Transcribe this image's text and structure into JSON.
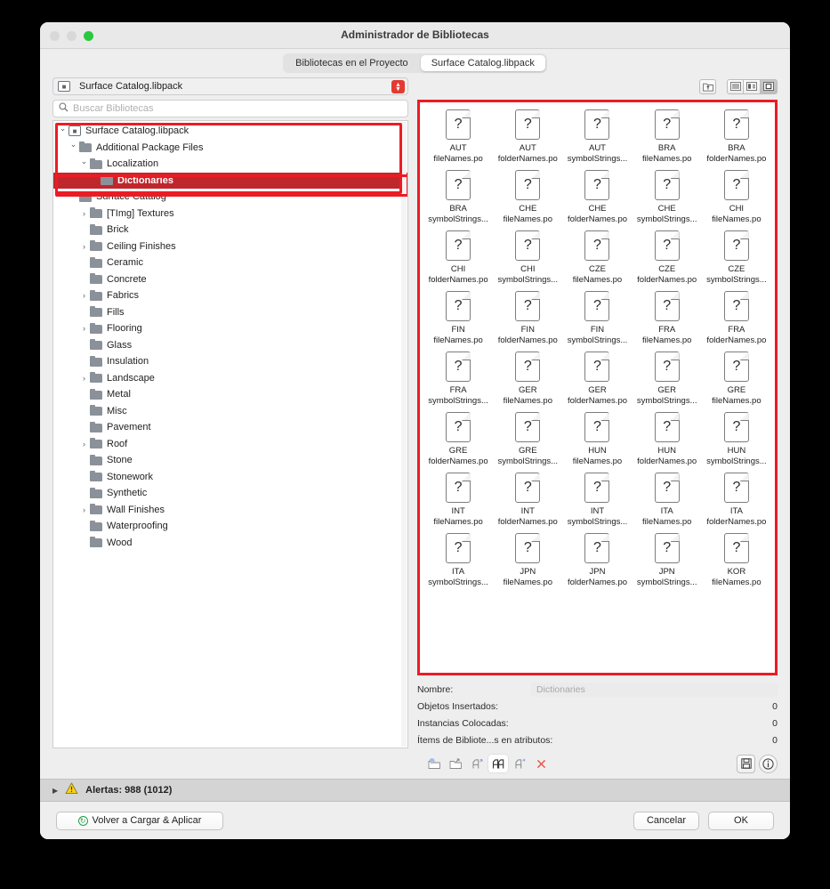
{
  "window": {
    "title": "Administrador de Bibliotecas",
    "traffic": {
      "close": "close-button",
      "minimize": "minimize-button",
      "maximize": "maximize-button"
    }
  },
  "tabs": [
    {
      "label": "Bibliotecas en el Proyecto",
      "active": false
    },
    {
      "label": "Surface Catalog.libpack",
      "active": true
    }
  ],
  "pathbar": {
    "value": "Surface Catalog.libpack"
  },
  "search": {
    "placeholder": "Buscar Bibliotecas",
    "value": ""
  },
  "tree": [
    {
      "label": "Surface Catalog.libpack",
      "depth": 0,
      "disc": "open",
      "icon": "package",
      "selected": false
    },
    {
      "label": "Additional Package Files",
      "depth": 1,
      "disc": "open",
      "icon": "folder",
      "selected": false
    },
    {
      "label": "Localization",
      "depth": 2,
      "disc": "open",
      "icon": "folder",
      "selected": false
    },
    {
      "label": "Dictionaries",
      "depth": 3,
      "disc": "none",
      "icon": "folder",
      "selected": true
    },
    {
      "label": "Surface Catalog",
      "depth": 1,
      "disc": "open",
      "icon": "folder",
      "selected": false
    },
    {
      "label": "[TImg] Textures",
      "depth": 2,
      "disc": "closed",
      "icon": "folder",
      "selected": false
    },
    {
      "label": "Brick",
      "depth": 2,
      "disc": "none",
      "icon": "folder",
      "selected": false
    },
    {
      "label": "Ceiling Finishes",
      "depth": 2,
      "disc": "closed",
      "icon": "folder",
      "selected": false
    },
    {
      "label": "Ceramic",
      "depth": 2,
      "disc": "none",
      "icon": "folder",
      "selected": false
    },
    {
      "label": "Concrete",
      "depth": 2,
      "disc": "none",
      "icon": "folder",
      "selected": false
    },
    {
      "label": "Fabrics",
      "depth": 2,
      "disc": "closed",
      "icon": "folder",
      "selected": false
    },
    {
      "label": "Fills",
      "depth": 2,
      "disc": "none",
      "icon": "folder",
      "selected": false
    },
    {
      "label": "Flooring",
      "depth": 2,
      "disc": "closed",
      "icon": "folder",
      "selected": false
    },
    {
      "label": "Glass",
      "depth": 2,
      "disc": "none",
      "icon": "folder",
      "selected": false
    },
    {
      "label": "Insulation",
      "depth": 2,
      "disc": "none",
      "icon": "folder",
      "selected": false
    },
    {
      "label": "Landscape",
      "depth": 2,
      "disc": "closed",
      "icon": "folder",
      "selected": false
    },
    {
      "label": "Metal",
      "depth": 2,
      "disc": "none",
      "icon": "folder",
      "selected": false
    },
    {
      "label": "Misc",
      "depth": 2,
      "disc": "none",
      "icon": "folder",
      "selected": false
    },
    {
      "label": "Pavement",
      "depth": 2,
      "disc": "none",
      "icon": "folder",
      "selected": false
    },
    {
      "label": "Roof",
      "depth": 2,
      "disc": "closed",
      "icon": "folder",
      "selected": false
    },
    {
      "label": "Stone",
      "depth": 2,
      "disc": "none",
      "icon": "folder",
      "selected": false
    },
    {
      "label": "Stonework",
      "depth": 2,
      "disc": "none",
      "icon": "folder",
      "selected": false
    },
    {
      "label": "Synthetic",
      "depth": 2,
      "disc": "none",
      "icon": "folder",
      "selected": false
    },
    {
      "label": "Wall Finishes",
      "depth": 2,
      "disc": "closed",
      "icon": "folder",
      "selected": false
    },
    {
      "label": "Waterproofing",
      "depth": 2,
      "disc": "none",
      "icon": "folder",
      "selected": false
    },
    {
      "label": "Wood",
      "depth": 2,
      "disc": "none",
      "icon": "folder",
      "selected": false
    }
  ],
  "view_toolbar": {
    "enclosing_folder": "folder-up-icon",
    "modes": [
      {
        "icon": "list-view-icon",
        "active": false
      },
      {
        "icon": "detail-view-icon",
        "active": false
      },
      {
        "icon": "icon-view-icon",
        "active": true
      }
    ]
  },
  "files": [
    {
      "line1": "AUT",
      "line2": "fileNames.po"
    },
    {
      "line1": "AUT",
      "line2": "folderNames.po"
    },
    {
      "line1": "AUT",
      "line2": "symbolStrings..."
    },
    {
      "line1": "BRA",
      "line2": "fileNames.po"
    },
    {
      "line1": "BRA",
      "line2": "folderNames.po"
    },
    {
      "line1": "BRA",
      "line2": "symbolStrings..."
    },
    {
      "line1": "CHE",
      "line2": "fileNames.po"
    },
    {
      "line1": "CHE",
      "line2": "folderNames.po"
    },
    {
      "line1": "CHE",
      "line2": "symbolStrings..."
    },
    {
      "line1": "CHI",
      "line2": "fileNames.po"
    },
    {
      "line1": "CHI",
      "line2": "folderNames.po"
    },
    {
      "line1": "CHI",
      "line2": "symbolStrings..."
    },
    {
      "line1": "CZE",
      "line2": "fileNames.po"
    },
    {
      "line1": "CZE",
      "line2": "folderNames.po"
    },
    {
      "line1": "CZE",
      "line2": "symbolStrings..."
    },
    {
      "line1": "FIN",
      "line2": "fileNames.po"
    },
    {
      "line1": "FIN",
      "line2": "folderNames.po"
    },
    {
      "line1": "FIN",
      "line2": "symbolStrings..."
    },
    {
      "line1": "FRA",
      "line2": "fileNames.po"
    },
    {
      "line1": "FRA",
      "line2": "folderNames.po"
    },
    {
      "line1": "FRA",
      "line2": "symbolStrings..."
    },
    {
      "line1": "GER",
      "line2": "fileNames.po"
    },
    {
      "line1": "GER",
      "line2": "folderNames.po"
    },
    {
      "line1": "GER",
      "line2": "symbolStrings..."
    },
    {
      "line1": "GRE",
      "line2": "fileNames.po"
    },
    {
      "line1": "GRE",
      "line2": "folderNames.po"
    },
    {
      "line1": "GRE",
      "line2": "symbolStrings..."
    },
    {
      "line1": "HUN",
      "line2": "fileNames.po"
    },
    {
      "line1": "HUN",
      "line2": "folderNames.po"
    },
    {
      "line1": "HUN",
      "line2": "symbolStrings..."
    },
    {
      "line1": "INT",
      "line2": "fileNames.po"
    },
    {
      "line1": "INT",
      "line2": "folderNames.po"
    },
    {
      "line1": "INT",
      "line2": "symbolStrings..."
    },
    {
      "line1": "ITA",
      "line2": "fileNames.po"
    },
    {
      "line1": "ITA",
      "line2": "folderNames.po"
    },
    {
      "line1": "ITA",
      "line2": "symbolStrings..."
    },
    {
      "line1": "JPN",
      "line2": "fileNames.po"
    },
    {
      "line1": "JPN",
      "line2": "folderNames.po"
    },
    {
      "line1": "JPN",
      "line2": "symbolStrings..."
    },
    {
      "line1": "KOR",
      "line2": "fileNames.po"
    }
  ],
  "file_icon_glyph": "?",
  "info": {
    "name_label": "Nombre:",
    "name_value": "Dictionaries",
    "rows": [
      {
        "label": "Objetos Insertados:",
        "value": "0"
      },
      {
        "label": "Instancias Colocadas:",
        "value": "0"
      },
      {
        "label": "Ítems de Bibliote...s en atributos:",
        "value": "0"
      }
    ]
  },
  "action_toolbar": {
    "items": [
      {
        "icon": "import-folder-icon",
        "active": false
      },
      {
        "icon": "export-folder-icon",
        "active": false
      },
      {
        "icon": "object-add-icon",
        "active": false
      },
      {
        "icon": "object-group-icon",
        "active": true
      },
      {
        "icon": "object-replace-icon",
        "active": false
      },
      {
        "icon": "delete-x-icon",
        "active": false
      }
    ],
    "right": [
      {
        "icon": "save-disk-icon"
      },
      {
        "icon": "info-icon"
      }
    ]
  },
  "alerts": {
    "label": "Alertas: 988 (1012)",
    "disclosure": "collapsed",
    "icon": "warning-triangle-icon"
  },
  "footer": {
    "reload": "Volver a Cargar & Aplicar",
    "cancel": "Cancelar",
    "ok": "OK"
  },
  "colors": {
    "annotation_red": "#ec1c24",
    "selection_red": "#c0272d",
    "stepper_red": "#e23b32",
    "traffic_green": "#29c83f",
    "warning_yellow": "#f5d21e"
  }
}
